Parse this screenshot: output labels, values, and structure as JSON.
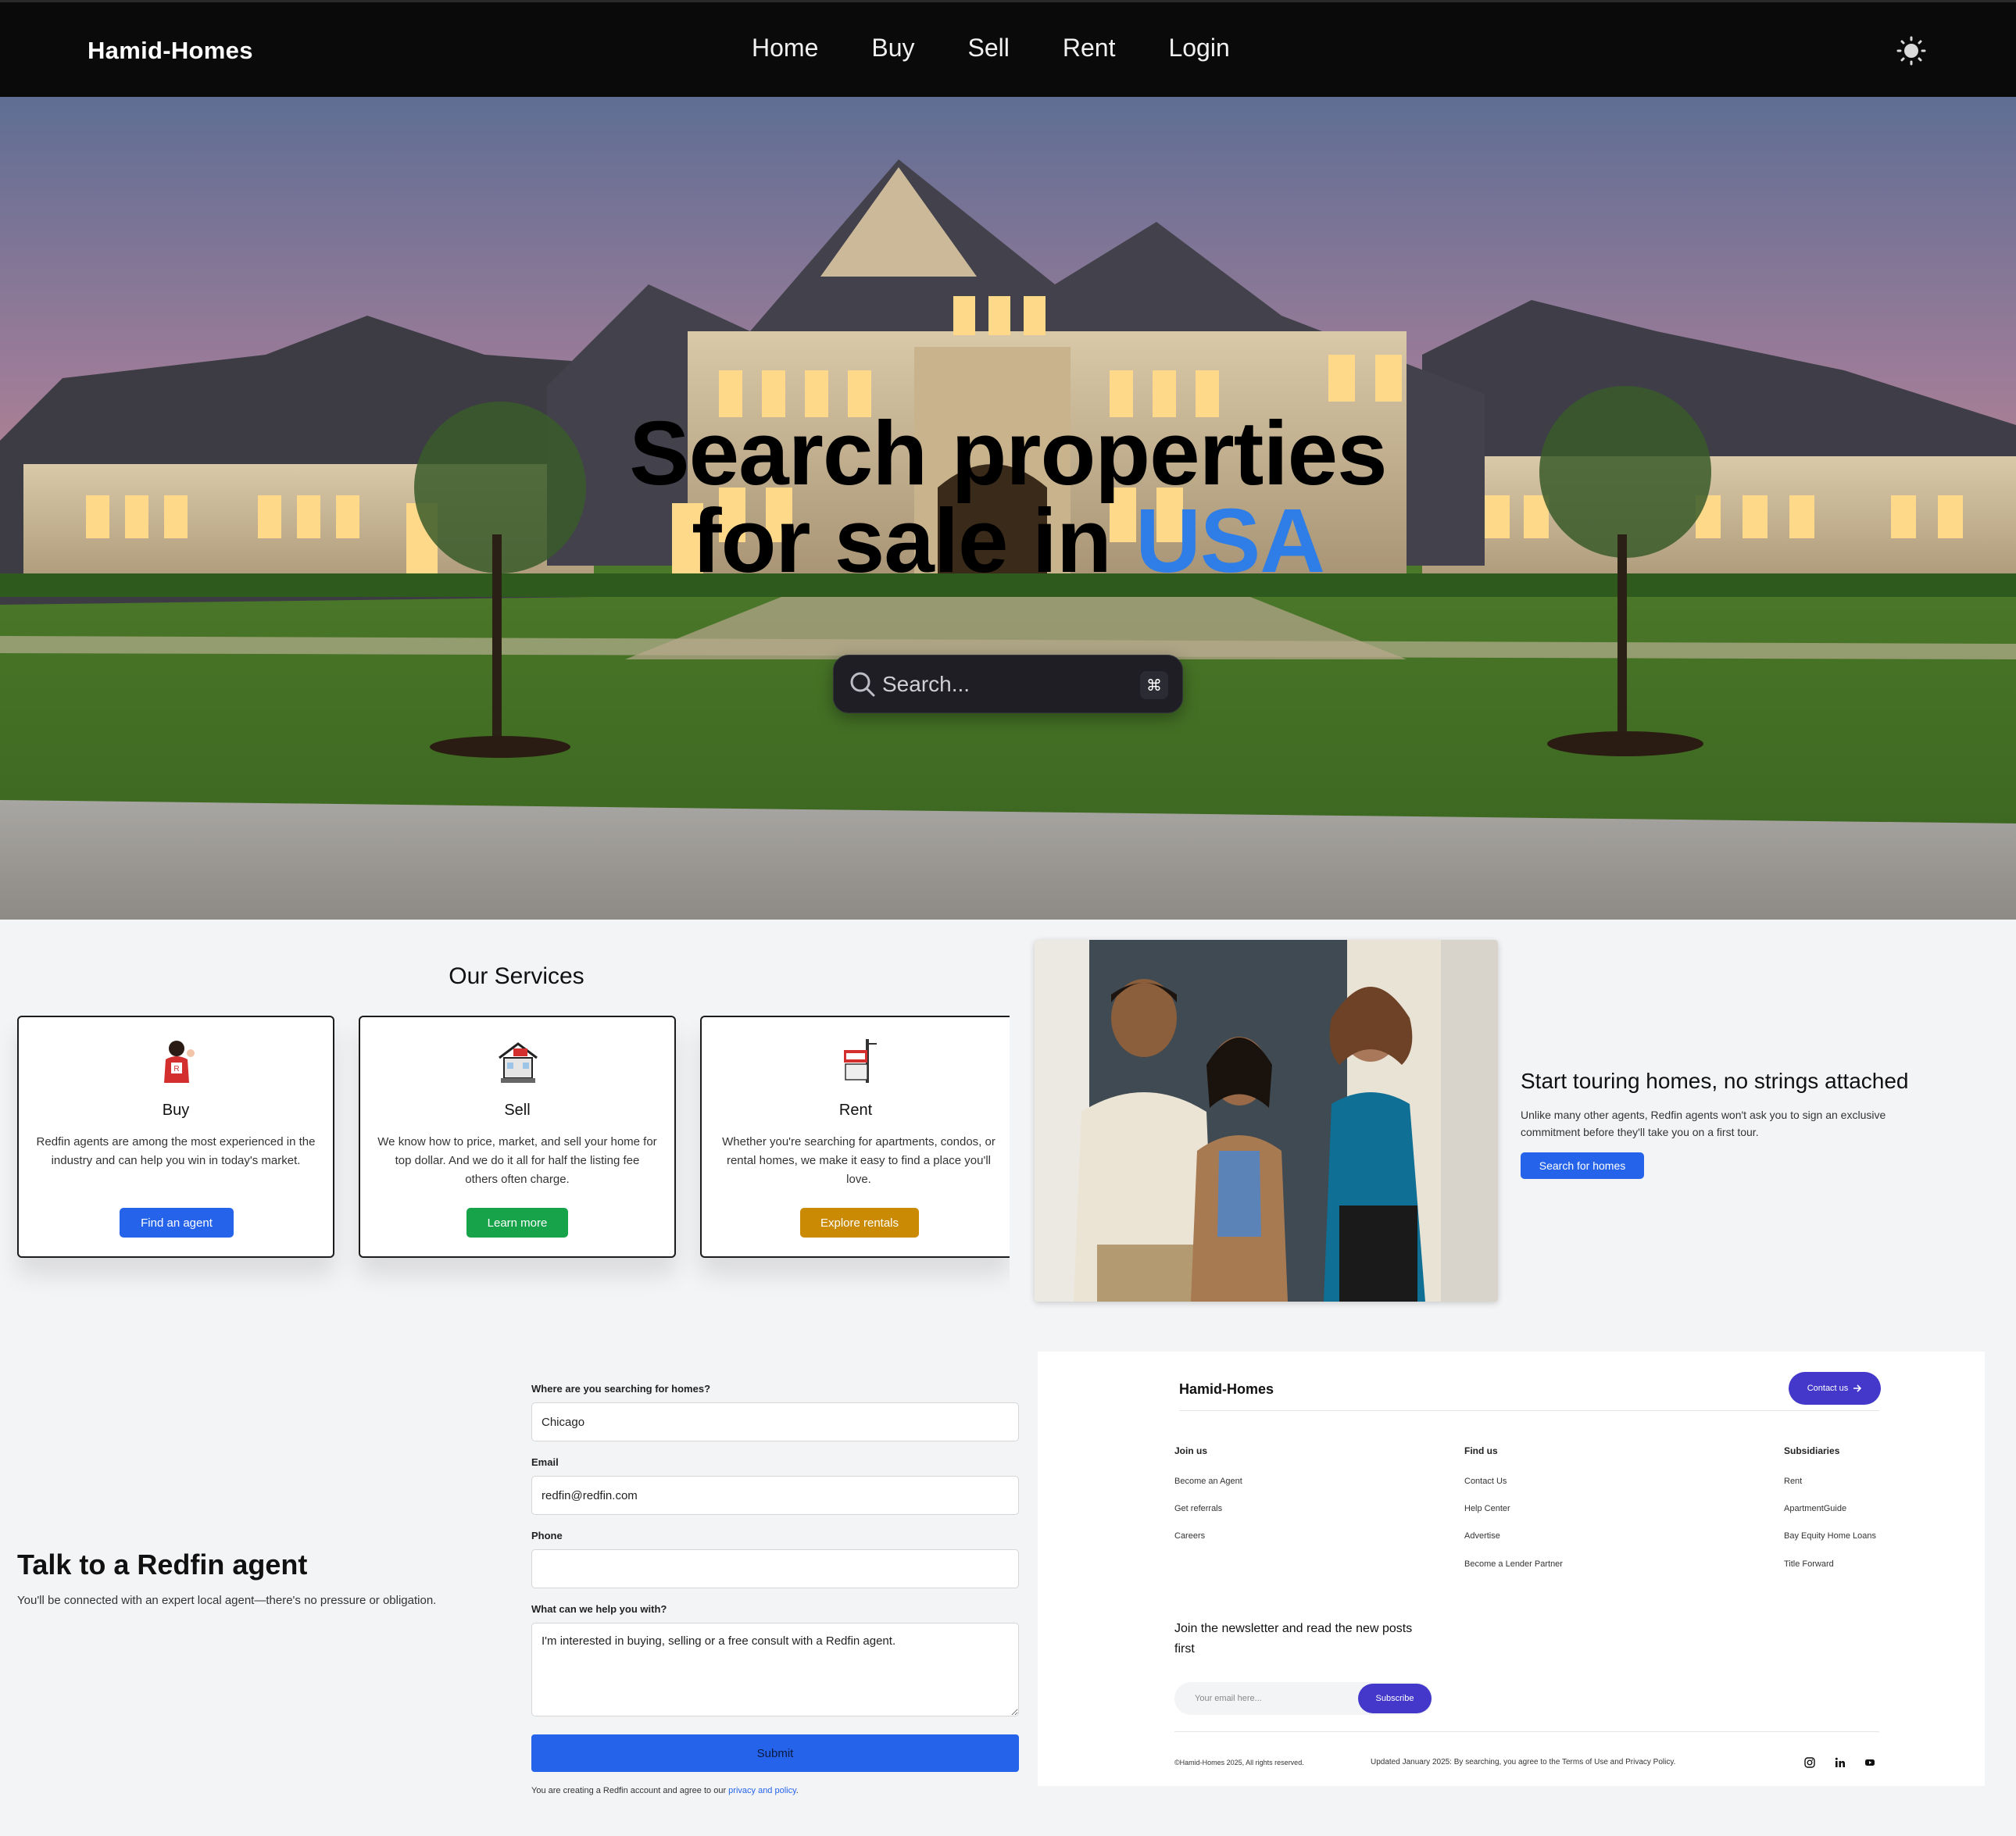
{
  "nav": {
    "brand": "Hamid-Homes",
    "links": [
      "Home",
      "Buy",
      "Sell",
      "Rent",
      "Login"
    ],
    "theme_icon": "sun-icon"
  },
  "hero": {
    "title_line1": "Search properties",
    "title_line2_prefix": "for sale in",
    "title_accent": "USA",
    "search_placeholder": "Search...",
    "search_shortcut": "⌘",
    "accent_color": "#2f7de6"
  },
  "services": {
    "title": "Our Services",
    "cards": [
      {
        "title": "Buy",
        "text": "Redfin agents are among the most experienced in the industry and can help you win in today's market.",
        "button": "Find an agent",
        "color": "#2563eb",
        "icon": "agent-icon"
      },
      {
        "title": "Sell",
        "text": "We know how to price, market, and sell your home for top dollar. And we do it all for half the listing fee others often charge.",
        "button": "Learn more",
        "color": "#16a34a",
        "icon": "house-for-sale-icon"
      },
      {
        "title": "Rent",
        "text": "Whether you're searching for apartments, condos, or rental homes, we make it easy to find a place you'll love.",
        "button": "Explore rentals",
        "color": "#ca8a04",
        "icon": "for-rent-sign-icon"
      }
    ]
  },
  "touring": {
    "title": "Start touring homes, no strings attached",
    "text": "Unlike many other agents, Redfin agents won't ask you to sign an exclusive commitment before they'll take you on a first tour.",
    "button": "Search for homes"
  },
  "agent": {
    "title": "Talk to a Redfin agent",
    "subtitle": "You'll be connected with an expert local agent—there's no pressure or obligation.",
    "fields": {
      "location_label": "Where are you searching for homes?",
      "location_value": "Chicago",
      "email_label": "Email",
      "email_value": "redfin@redfin.com",
      "phone_label": "Phone",
      "phone_value": "",
      "message_label": "What can we help you with?",
      "message_value": "I'm interested in buying, selling or a free consult with a Redfin agent."
    },
    "submit": "Submit",
    "legal_prefix": "You are creating a Redfin account and agree to our",
    "legal_link": "privacy and policy",
    "legal_suffix": "."
  },
  "footer": {
    "brand": "Hamid-Homes",
    "contact_button": "Contact us",
    "columns": [
      {
        "title": "Join us",
        "links": [
          "Become an Agent",
          "Get referrals",
          "Careers"
        ]
      },
      {
        "title": "Find us",
        "links": [
          "Contact Us",
          "Help Center",
          "Advertise",
          "Become a Lender Partner"
        ]
      },
      {
        "title": "Subsidiaries",
        "links": [
          "Rent",
          "ApartmentGuide",
          "Bay Equity Home Loans",
          "Title Forward"
        ]
      }
    ],
    "newsletter_title": "Join the newsletter and read the new posts first",
    "email_placeholder": "Your email here...",
    "subscribe": "Subscribe",
    "copyright": "©Hamid-Homes 2025, All rights reserved.",
    "updated": "Updated January 2025: By searching, you agree to the Terms of Use and Privacy Policy.",
    "social": [
      "instagram-icon",
      "linkedin-icon",
      "youtube-icon"
    ]
  }
}
